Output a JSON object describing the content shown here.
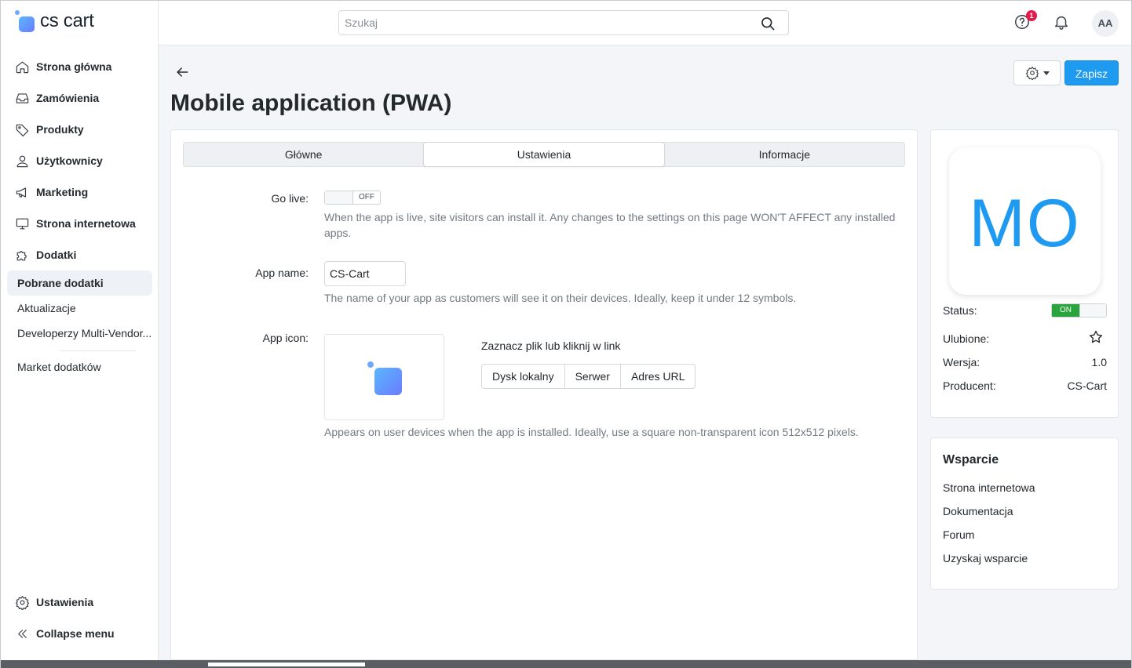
{
  "brand": {
    "name": "cs cart"
  },
  "search": {
    "placeholder": "Szukaj"
  },
  "topbar": {
    "notification_count": "1",
    "avatar_initials": "AA"
  },
  "sidebar": {
    "items": [
      {
        "label": "Strona główna",
        "icon": "home-icon"
      },
      {
        "label": "Zamówienia",
        "icon": "inbox-icon"
      },
      {
        "label": "Produkty",
        "icon": "tag-icon"
      },
      {
        "label": "Użytkownicy",
        "icon": "user-icon"
      },
      {
        "label": "Marketing",
        "icon": "megaphone-icon"
      },
      {
        "label": "Strona internetowa",
        "icon": "monitor-icon"
      },
      {
        "label": "Dodatki",
        "icon": "puzzle-icon"
      }
    ],
    "subitems": [
      {
        "label": "Pobrane dodatki",
        "active": true
      },
      {
        "label": "Aktualizacje"
      },
      {
        "label": "Developerzy Multi-Vendor..."
      },
      {
        "label": "Market dodatków"
      }
    ],
    "bottom": [
      {
        "label": "Ustawienia",
        "icon": "gear-icon"
      },
      {
        "label": "Collapse menu",
        "icon": "double-chevron-left-icon"
      }
    ]
  },
  "header": {
    "title": "Mobile application (PWA)",
    "save_label": "Zapisz"
  },
  "tabs": [
    {
      "label": "Główne"
    },
    {
      "label": "Ustawienia",
      "active": true
    },
    {
      "label": "Informacje"
    }
  ],
  "form": {
    "go_live": {
      "label": "Go live:",
      "state": "OFF",
      "help": "When the app is live, site visitors can install it. Any changes to the settings on this page WON'T AFFECT any installed apps."
    },
    "app_name": {
      "label": "App name:",
      "value": "CS-Cart",
      "help": "The name of your app as customers will see it on their devices. Ideally, keep it under 12 symbols."
    },
    "app_icon": {
      "label": "App icon:",
      "upload_hint": "Zaznacz plik lub kliknij w link",
      "buttons": [
        "Dysk lokalny",
        "Serwer",
        "Adres URL"
      ],
      "help": "Appears on user devices when the app is installed. Ideally, use a square non-transparent icon 512x512 pixels."
    }
  },
  "addon_info": {
    "logo_text": "MO",
    "status_label": "Status:",
    "status_value": "ON",
    "favorite_label": "Ulubione:",
    "version_label": "Wersja:",
    "version_value": "1.0",
    "developer_label": "Producent:",
    "developer_value": "CS-Cart"
  },
  "support": {
    "title": "Wsparcie",
    "links": [
      "Strona internetowa",
      "Dokumentacja",
      "Forum",
      "Uzyskaj wsparcie"
    ]
  },
  "colors": {
    "accent": "#1e9bf0",
    "on": "#2aa43c",
    "badge": "#e5194b"
  }
}
